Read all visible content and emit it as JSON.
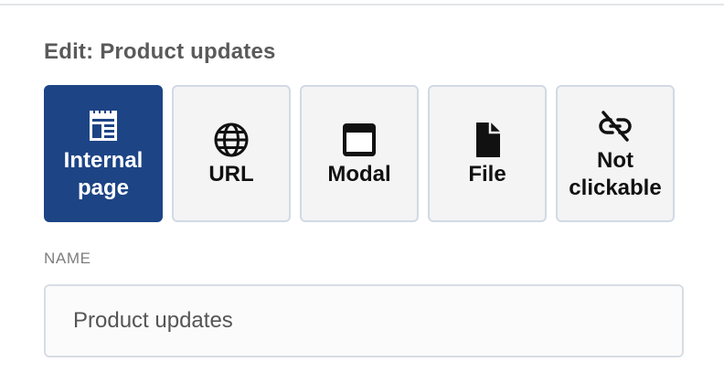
{
  "panel": {
    "title": "Edit: Product updates"
  },
  "link_types": [
    {
      "label": "Internal page",
      "icon": "internal-page-icon",
      "selected": true
    },
    {
      "label": "URL",
      "icon": "globe-icon",
      "selected": false
    },
    {
      "label": "Modal",
      "icon": "modal-window-icon",
      "selected": false
    },
    {
      "label": "File",
      "icon": "file-icon",
      "selected": false
    },
    {
      "label": "Not clickable",
      "icon": "link-off-icon",
      "selected": false
    }
  ],
  "name_field": {
    "label": "NAME",
    "value": "Product updates"
  },
  "colors": {
    "selected_bg": "#1d4485",
    "option_bg": "#f4f4f5",
    "option_border": "#d2dae5"
  }
}
